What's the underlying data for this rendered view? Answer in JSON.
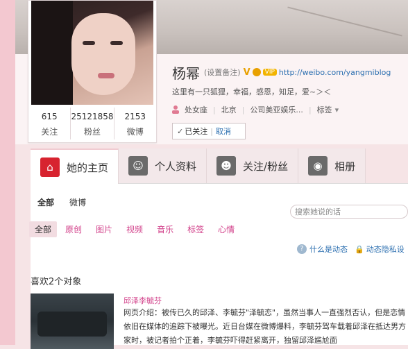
{
  "profile": {
    "name": "杨幂",
    "remark_link": "(设置备注)",
    "verified_badge": "V",
    "vip_badge": "VIP",
    "url": "http://weibo.com/yangmiblog",
    "intro": "这里有一只狐狸，幸福，感恩，知足，爱~＞＜",
    "meta": [
      "处女座",
      "北京",
      "公司美亚娱乐..."
    ],
    "tags_link": "标签",
    "follow_status": "已关注",
    "follow_check": "✓",
    "cancel_label": "取消"
  },
  "stats": [
    {
      "value": "615",
      "label": "关注"
    },
    {
      "value": "25121858",
      "label": "粉丝"
    },
    {
      "value": "2153",
      "label": "微博"
    }
  ],
  "tabs": [
    {
      "label": "她的主页",
      "icon": "home-icon"
    },
    {
      "label": "个人资料",
      "icon": "profile-icon"
    },
    {
      "label": "关注/粉丝",
      "icon": "follow-icon"
    },
    {
      "label": "相册",
      "icon": "camera-icon"
    }
  ],
  "sub_tabs": [
    "全部",
    "微博"
  ],
  "search_placeholder": "搜索她说的话",
  "filters": [
    "全部",
    "原创",
    "图片",
    "视频",
    "音乐",
    "标签",
    "心情"
  ],
  "help": {
    "what_is_feed": "什么是动态",
    "feed_privacy": "动态隐私设"
  },
  "likes": {
    "title": "喜欢2个对象",
    "item_title": "邱泽李毓芬",
    "item_text": "网页介绍：被传已久的邱泽、李毓芬\"泽毓恋\"，虽然当事人一直强烈否认，但是恋情依旧在媒体的追踪下被曝光。近日台媒在微博爆料，李毓芬驾车载着邱泽在抵达男方家时，被记者拍个正着，李毓芬吓得赶紧离开，独留邱泽尴尬面"
  },
  "colors": {
    "accent": "#d7232f",
    "pink": "#d2408a",
    "link": "#2c6fb0"
  }
}
